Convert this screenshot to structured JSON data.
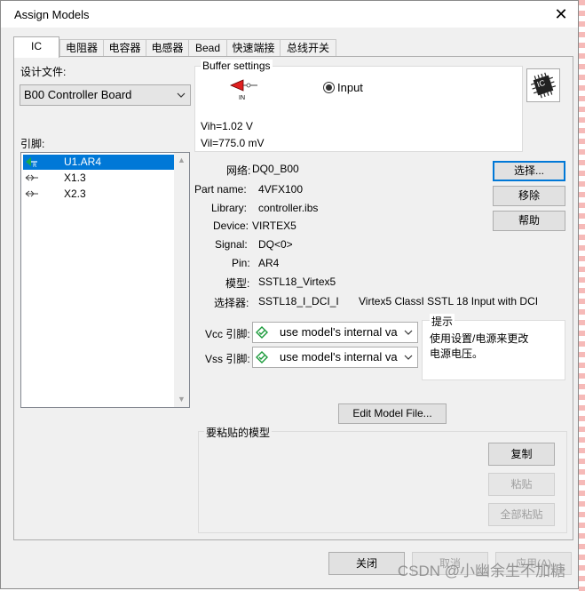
{
  "window": {
    "title": "Assign Models",
    "close_glyph": "✕"
  },
  "tabs": [
    {
      "label": "IC",
      "active": true
    },
    {
      "label": "电阻器"
    },
    {
      "label": "电容器"
    },
    {
      "label": "电感器"
    },
    {
      "label": "Bead"
    },
    {
      "label": "快速端接"
    },
    {
      "label": "总线开关"
    }
  ],
  "left": {
    "design_file_label": "设计文件:",
    "design_file_value": "B00 Controller Board",
    "pins_label": "引脚:",
    "pins": [
      {
        "icon": "receiver-pin-icon",
        "label": "U1.AR4",
        "selected": true
      },
      {
        "icon": "bidirectional-pin-icon",
        "label": "X1.3"
      },
      {
        "icon": "bidirectional-pin-icon",
        "label": "X2.3"
      }
    ]
  },
  "buffer": {
    "group_title": "Buffer settings",
    "symbol_caption": "IN",
    "radio_label": "Input",
    "vih": "Vih=1.02 V",
    "vil": "Vil=775.0 mV",
    "chip_icon_text": "IC"
  },
  "details": {
    "net_label": "网络:",
    "net_value": "DQ0_B00",
    "part_label": "Part name:",
    "part_value": "4VFX100",
    "library_label": "Library:",
    "library_value": "controller.ibs",
    "device_label": "Device:",
    "device_value": "VIRTEX5",
    "signal_label": "Signal:",
    "signal_value": "DQ<0>",
    "pin_label": "Pin:",
    "pin_value": "AR4",
    "model_label": "模型:",
    "model_value": "SSTL18_Virtex5",
    "selector_label": "选择器:",
    "selector_value": "SSTL18_I_DCI_I",
    "selector_desc": "Virtex5 ClassI SSTL 18 Input with DCI"
  },
  "side_buttons": {
    "select": "选择...",
    "remove": "移除",
    "help": "帮助"
  },
  "power": {
    "vcc_label": "Vcc 引脚:",
    "vcc_value": "use model's internal va",
    "vss_label": "Vss 引脚:",
    "vss_value": "use model's internal va"
  },
  "hint": {
    "title": "提示",
    "text_line1": "使用设置/电源来更改",
    "text_line2": "电源电压。"
  },
  "edit_model_button": "Edit Model File...",
  "paste_group": {
    "title": "要粘贴的模型",
    "copy": "复制",
    "paste": "粘贴",
    "paste_all": "全部粘贴"
  },
  "footer": {
    "close": "关闭",
    "cancel": "取消",
    "apply": "应用(A)"
  },
  "watermark": "CSDN @小幽余生不加糖",
  "colors": {
    "selection": "#0078d7",
    "default_border": "#0078d7",
    "arrow_red": "#e02020"
  }
}
